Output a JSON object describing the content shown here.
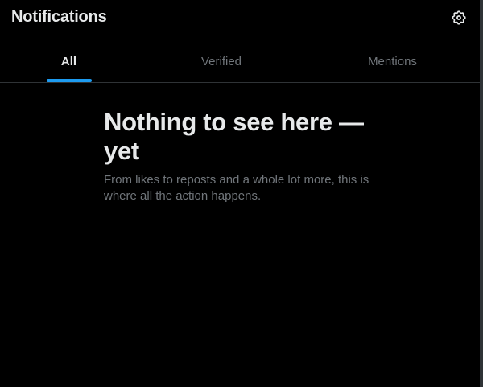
{
  "header": {
    "title": "Notifications",
    "settings_icon": "gear-icon"
  },
  "tabs": [
    {
      "label": "All",
      "active": true
    },
    {
      "label": "Verified",
      "active": false
    },
    {
      "label": "Mentions",
      "active": false
    }
  ],
  "empty_state": {
    "title": "Nothing to see here — yet",
    "subtitle": "From likes to reposts and a whole lot more, this is where all the action happens."
  },
  "colors": {
    "background": "#000000",
    "accent": "#1d9bf0",
    "text_primary": "#e7e9ea",
    "text_secondary": "#71767b",
    "divider": "#2f3336"
  }
}
